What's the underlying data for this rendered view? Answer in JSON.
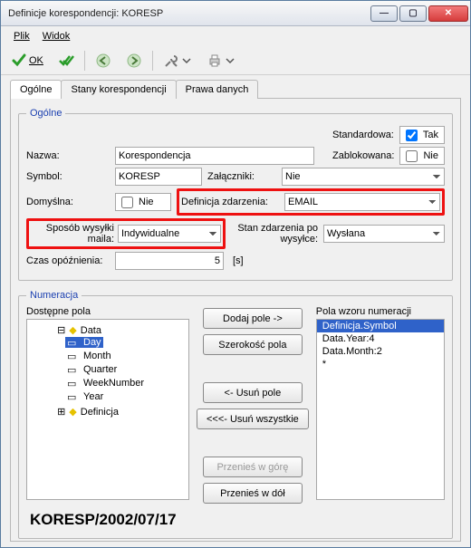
{
  "window": {
    "title": "Definicje korespondencji: KORESP"
  },
  "menu": {
    "file": "Plik",
    "view": "Widok"
  },
  "toolbar": {
    "ok": "OK"
  },
  "tabs": {
    "general": "Ogólne",
    "states": "Stany korespondencji",
    "rights": "Prawa danych"
  },
  "group_general": {
    "legend": "Ogólne",
    "name_lab": "Nazwa:",
    "name_val": "Korespondencja",
    "symbol_lab": "Symbol:",
    "symbol_val": "KORESP",
    "default_lab": "Domyślna:",
    "default_chk_lab": "Nie",
    "attachments_lab": "Załączniki:",
    "attachments_val": "Nie",
    "eventdef_lab": "Definicja zdarzenia:",
    "eventdef_val": "EMAIL",
    "sendmode_lab": "Sposób wysyłki maila:",
    "sendmode_val": "Indywidualne",
    "eventstate_lab": "Stan zdarzenia po wysyłce:",
    "eventstate_val": "Wysłana",
    "delay_lab": "Czas opóźnienia:",
    "delay_val": "5",
    "delay_unit": "[s]",
    "standard_lab": "Standardowa:",
    "standard_chk_lab": "Tak",
    "locked_lab": "Zablokowana:",
    "locked_chk_lab": "Nie"
  },
  "group_num": {
    "legend": "Numeracja",
    "avail_lab": "Dostępne pola",
    "pattern_lab": "Pola wzoru numeracji",
    "tree": {
      "root": "Data",
      "children": [
        "Day",
        "Month",
        "Quarter",
        "WeekNumber",
        "Year"
      ],
      "root2": "Definicja"
    },
    "buttons": {
      "add": "Dodaj pole ->",
      "width": "Szerokość pola",
      "del": "<- Usuń pole",
      "delall": "<<<- Usuń wszystkie",
      "up": "Przenieś w górę",
      "down": "Przenieś w dół"
    },
    "pattern_items": [
      "Definicja.Symbol",
      "Data.Year:4",
      "Data.Month:2",
      "*"
    ],
    "footer": "KORESP/2002/07/17"
  }
}
